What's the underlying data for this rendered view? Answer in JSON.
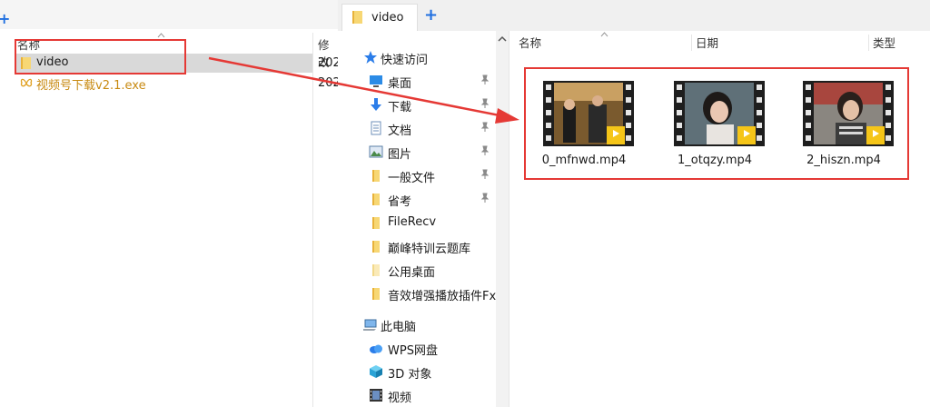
{
  "left_pane": {
    "columns": {
      "name": "名称",
      "modified": "修改"
    },
    "rows": [
      {
        "name": "video",
        "modified": "202"
      },
      {
        "name": "视频号下载v2.1.exe",
        "modified": "202"
      }
    ]
  },
  "right_window": {
    "tab": {
      "label": "video"
    },
    "nav": [
      {
        "label": "快速访问",
        "icon": "star-icon",
        "pinned": false
      },
      {
        "label": "桌面",
        "icon": "desktop-icon",
        "pinned": true
      },
      {
        "label": "下载",
        "icon": "download-icon",
        "pinned": true
      },
      {
        "label": "文档",
        "icon": "document-icon",
        "pinned": true
      },
      {
        "label": "图片",
        "icon": "pictures-icon",
        "pinned": true
      },
      {
        "label": "一般文件",
        "icon": "folder-icon",
        "pinned": true
      },
      {
        "label": "省考",
        "icon": "folder-icon",
        "pinned": true
      },
      {
        "label": "FileRecv",
        "icon": "folder-icon",
        "pinned": false
      },
      {
        "label": "巅峰特训云题库",
        "icon": "folder-icon",
        "pinned": false
      },
      {
        "label": "公用桌面",
        "icon": "folder-icon",
        "pinned": false
      },
      {
        "label": "音效增强播放插件Fx",
        "icon": "folder-icon",
        "pinned": false
      },
      {
        "label": "此电脑",
        "icon": "computer-icon",
        "pinned": false
      },
      {
        "label": "WPS网盘",
        "icon": "cloud-icon",
        "pinned": false
      },
      {
        "label": "3D 对象",
        "icon": "cube-icon",
        "pinned": false
      },
      {
        "label": "视频",
        "icon": "video-icon",
        "pinned": false
      }
    ],
    "columns": {
      "name": "名称",
      "date": "日期",
      "type": "类型"
    },
    "files": [
      {
        "name": "0_mfnwd.mp4",
        "badge": "Player"
      },
      {
        "name": "1_otqzy.mp4",
        "badge": "Player"
      },
      {
        "name": "2_hiszn.mp4",
        "badge": "Player"
      }
    ]
  },
  "colors": {
    "highlight": "#e53935",
    "accent": "#1f6fe0",
    "folder": "#f2c14e",
    "badge": "#f5c518"
  }
}
